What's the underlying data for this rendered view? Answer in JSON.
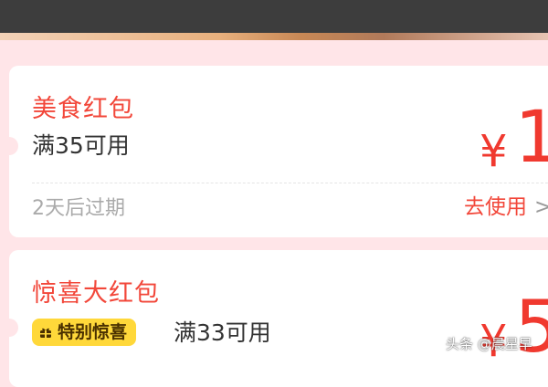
{
  "coupons": [
    {
      "title": "美食红包",
      "condition": "满35可用",
      "expiry": "2天后过期",
      "use_label": "去使用",
      "use_arrow": ">",
      "currency": "¥",
      "amount_visible": "1"
    },
    {
      "title": "惊喜大红包",
      "badge_label": "特别惊喜",
      "badge_icon": "gift-icon",
      "condition": "满33可用",
      "currency": "¥",
      "amount_visible": "5"
    }
  ],
  "watermark": "头条 @晨星早",
  "colors": {
    "accent": "#f2473a",
    "badge": "#ffd83a",
    "background": "#ffe5e8",
    "topbar": "#3d3d3d"
  }
}
